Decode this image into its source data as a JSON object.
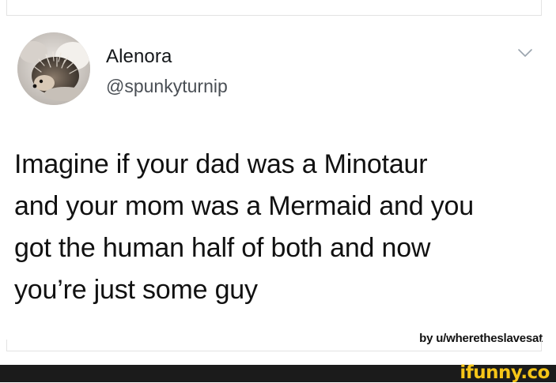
{
  "tweet": {
    "author": {
      "name": "Alenora",
      "handle": "@spunkyturnip"
    },
    "text_lines": [
      "Imagine if your dad was a Minotaur",
      "and your mom was a Mermaid and you",
      "got the human half of both and now",
      "you’re just some guy"
    ]
  },
  "credit": "by u/wheretheslavesat",
  "brand": "ifunny.co",
  "colors": {
    "text": "#111111",
    "handle": "#4a4f55",
    "footer_bg": "#1b1b1b",
    "brand_accent": "#f5c518"
  },
  "icons": {
    "menu": "chevron-down-icon",
    "avatar": "hedgehog-photo"
  }
}
